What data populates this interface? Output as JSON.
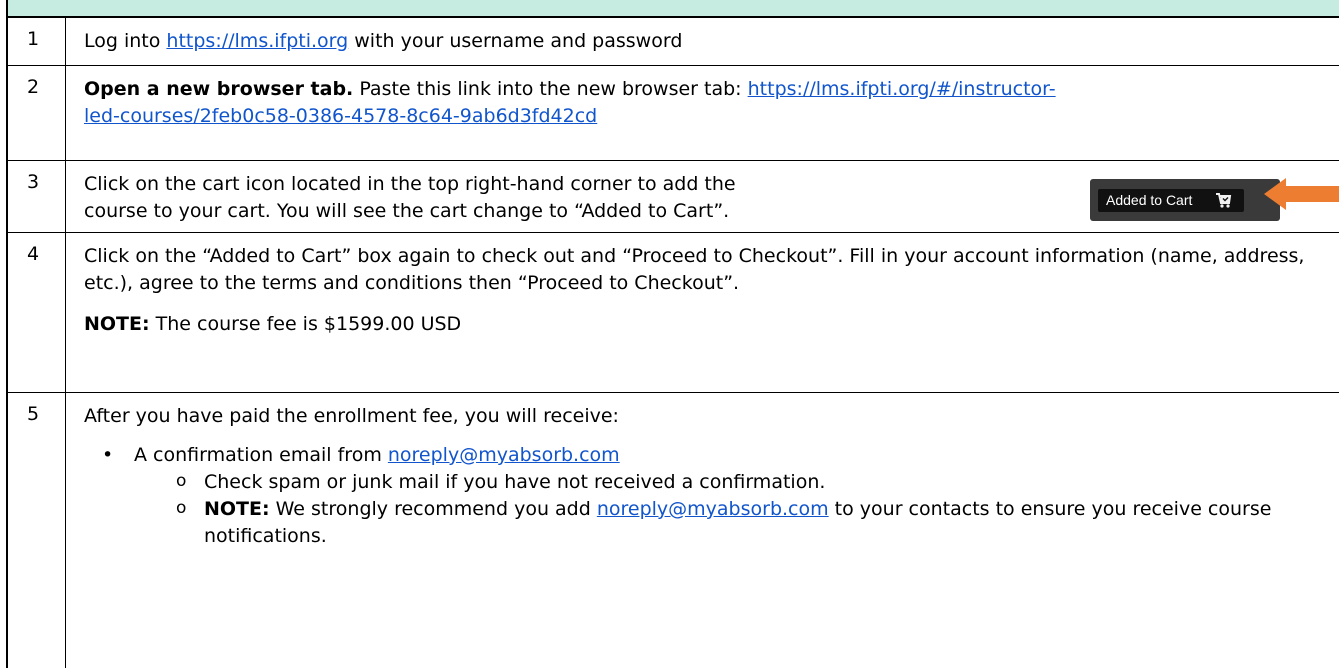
{
  "steps": [
    {
      "number": "1",
      "text_before": "Log into ",
      "link": "https://lms.ifpti.org",
      "text_after": " with your username and password"
    },
    {
      "number": "2",
      "bold": "Open a new browser tab.",
      "text": " Paste this link into the new browser tab: ",
      "link_line1": "https://lms.ifpti.org/#/instructor-",
      "link_line2": "led-courses/2feb0c58-0386-4578-8c64-9ab6d3fd42cd"
    },
    {
      "number": "3",
      "line1": "Click on the cart icon located in the top right-hand corner to add the",
      "line2": "course to your cart. You will see the cart change to “Added to Cart”.",
      "cart_label": "Added to Cart",
      "cart_icon": "cart-icon",
      "arrow_color": "#ed7d31"
    },
    {
      "number": "4",
      "paragraph": "Click on the “Added to Cart” box again to check out and “Proceed to Checkout”. Fill in your account information (name, address, etc.), agree to the terms and conditions then “Proceed to Checkout”.",
      "note_label": "NOTE:",
      "note_text": " The course fee is $1599.00 USD"
    },
    {
      "number": "5",
      "intro": "After you have paid the enrollment fee, you will receive:",
      "bullet_text": "A confirmation email from ",
      "bullet_link": "noreply@myabsorb.com",
      "sub1": "Check spam or junk mail if you have not received a confirmation.",
      "sub2_label": "NOTE:",
      "sub2_before": " We strongly recommend you add ",
      "sub2_link": "noreply@myabsorb.com",
      "sub2_after": " to your contacts to ensure you receive course notifications."
    }
  ],
  "colors": {
    "header_band": "#c6ece1",
    "link": "#1155cc",
    "arrow": "#ed7d31"
  }
}
